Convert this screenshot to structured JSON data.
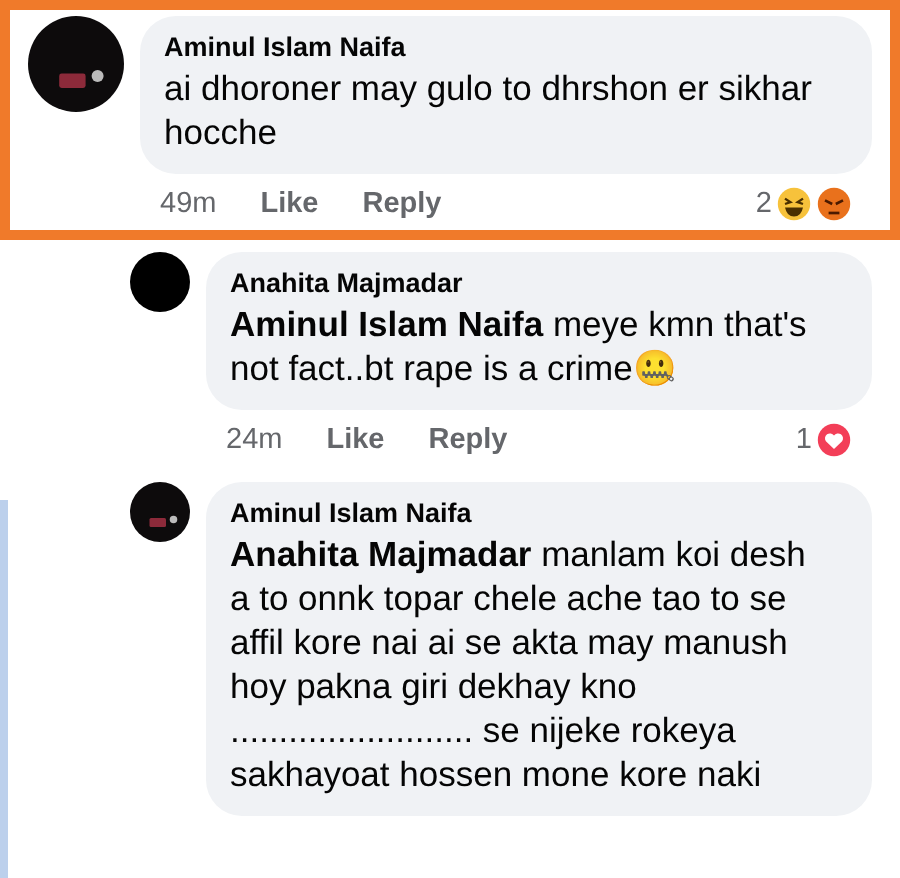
{
  "comments": [
    {
      "kind": "comment",
      "author": "Aminul Islam Naifa",
      "avatar": {
        "kind": "logo"
      },
      "highlighted": true,
      "text": "ai dhoroner may gulo to dhrshon er sikhar hocche",
      "time": "49m",
      "actions": [
        "Like",
        "Reply"
      ],
      "reaction_count": "2",
      "reactions": [
        {
          "kind": "haha"
        },
        {
          "kind": "angry"
        }
      ]
    },
    {
      "kind": "reply",
      "author": "Anahita Majmadar",
      "avatar": {
        "kind": "plain"
      },
      "highlighted": false,
      "text": "**Aminul Islam Naifa** meye kmn that's not fact..bt rape is a crime🤐",
      "time": "24m",
      "actions": [
        "Like",
        "Reply"
      ],
      "reaction_count": "1",
      "reactions": [
        {
          "kind": "love"
        }
      ]
    },
    {
      "kind": "reply",
      "author": "Aminul Islam Naifa",
      "avatar": {
        "kind": "logo"
      },
      "highlighted": false,
      "text": "**Anahita Majmadar** manlam koi desh a to onnk topar chele ache tao to se affil kore nai ai se akta may manush hoy pakna giri dekhay kno ......................... se nijeke rokeya sakhayoat hossen mone kore naki"
    }
  ]
}
